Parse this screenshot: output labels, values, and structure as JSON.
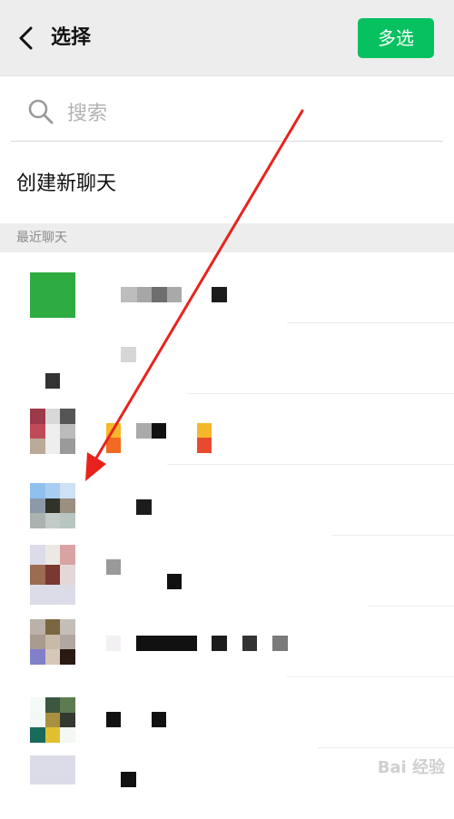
{
  "header": {
    "title": "选择",
    "multi_select_label": "多选"
  },
  "search": {
    "placeholder": "搜索",
    "value": ""
  },
  "new_chat": {
    "label": "创建新聊天"
  },
  "section": {
    "recent_label": "最近聊天"
  },
  "watermark": {
    "text": "Bai 经验"
  },
  "colors": {
    "accent": "#07c160",
    "arrow": "#e8231e",
    "header_bg": "#ededed"
  }
}
